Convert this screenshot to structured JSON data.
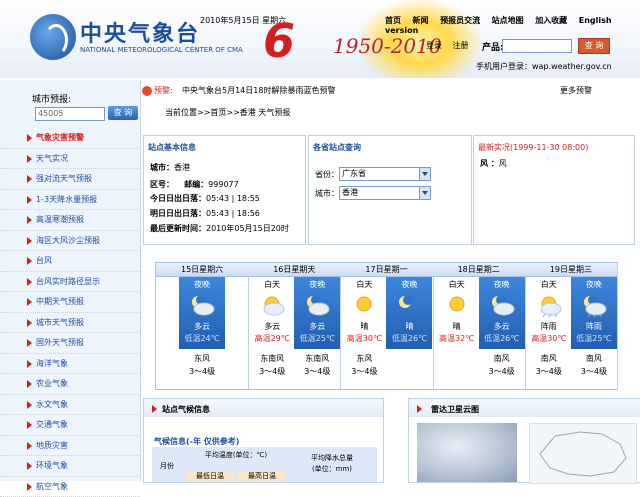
{
  "header": {
    "site_name_cn": "中央气象台",
    "site_name_en": "NATIONAL METEOROLOGICAL CENTER OF CMA",
    "date": "2010年5月15日 星期六",
    "anniversary_years": "1950-2010",
    "nav": [
      "首页",
      "新闻",
      "预报员交流",
      "站点地图",
      "加入收藏",
      "English version"
    ],
    "login": "登录",
    "register": "注册",
    "product_label": "产品:",
    "search_button": "查 询",
    "mobile_login": "手机用户登录：wap.weather.gov.cn"
  },
  "sidebar": {
    "city_label": "城市预报:",
    "city_input": "45005",
    "city_button": "查 询",
    "items": [
      {
        "label": "气象灾害预警",
        "active": true
      },
      {
        "label": "天气实况",
        "active": false
      },
      {
        "label": "强对流天气预报",
        "active": false
      },
      {
        "label": "1-3天降水量预报",
        "active": false
      },
      {
        "label": "高温寒潮预报",
        "active": false
      },
      {
        "label": "海区大风沙尘预报",
        "active": false
      },
      {
        "label": "台风",
        "active": false
      },
      {
        "label": "台风实时路径显示",
        "active": false
      },
      {
        "label": "中期天气预报",
        "active": false
      },
      {
        "label": "城市天气预报",
        "active": false
      },
      {
        "label": "国外天气预报",
        "active": false
      },
      {
        "label": "海洋气象",
        "active": false
      },
      {
        "label": "农业气象",
        "active": false
      },
      {
        "label": "水文气象",
        "active": false
      },
      {
        "label": "交通气象",
        "active": false
      },
      {
        "label": "地质灾害",
        "active": false
      },
      {
        "label": "环境气象",
        "active": false
      },
      {
        "label": "航空气象",
        "active": false
      }
    ]
  },
  "alert": {
    "tag": "预警:",
    "text": "中央气象台5月14日18时解除暴雨蓝色预警",
    "more": "更多预警"
  },
  "breadcrumb": "当前位置>>首页>>香港 天气预报",
  "station_info": {
    "title": "站点基本信息",
    "city_label": "城市：",
    "city": "香港",
    "zone_label": "区号：",
    "post_label": "邮编：",
    "post": "999077",
    "today_label": "今日日出日落：",
    "today": "05:43 | 18:55",
    "tomorrow_label": "明日日出日落：",
    "tomorrow": "05:43 | 18:56",
    "updated_label": "最后更新时间：",
    "updated": "2010年05月15日20时"
  },
  "province_panel": {
    "title": "各省站点查询",
    "province_label": "省份：",
    "province": "广东省",
    "city_label": "城市：",
    "city": "香港"
  },
  "latest_panel": {
    "title": "最新实况(1999-11-30 08:00)",
    "wind_label": "风 ：",
    "wind": "风"
  },
  "forecast": [
    {
      "date": "15日星期六",
      "day": null,
      "night": {
        "label": "夜晚",
        "icon": "cloudy-night-icon",
        "weather": "多云",
        "temp": "低温24℃",
        "wind": "东风",
        "force": "3～4级"
      }
    },
    {
      "date": "16日星期天",
      "day": {
        "label": "白天",
        "icon": "partly-cloudy-icon",
        "weather": "多云",
        "temp": "高温29℃",
        "wind": "东南风",
        "force": "3～4级"
      },
      "night": {
        "label": "夜晚",
        "icon": "cloudy-night-icon",
        "weather": "多云",
        "temp": "低温25℃",
        "wind": "东南风",
        "force": "3～4级"
      }
    },
    {
      "date": "17日星期一",
      "day": {
        "label": "白天",
        "icon": "sunny-icon",
        "weather": "晴",
        "temp": "高温30℃",
        "wind": "东风",
        "force": "3～4级"
      },
      "night": {
        "label": "夜晚",
        "icon": "clear-night-icon",
        "weather": "晴",
        "temp": "低温26℃",
        "wind": "",
        "force": ""
      }
    },
    {
      "date": "18日星期二",
      "day": {
        "label": "白天",
        "icon": "sunny-icon",
        "weather": "晴",
        "temp": "高温32℃",
        "wind": "",
        "force": ""
      },
      "night": {
        "label": "夜晚",
        "icon": "cloudy-night-icon",
        "weather": "多云",
        "temp": "低温26℃",
        "wind": "南风",
        "force": "3～4级"
      }
    },
    {
      "date": "19日星期三",
      "day": {
        "label": "白天",
        "icon": "shower-icon",
        "weather": "阵雨",
        "temp": "高温30℃",
        "wind": "南风",
        "force": "3～4级"
      },
      "night": {
        "label": "夜晚",
        "icon": "shower-night-icon",
        "weather": "阵雨",
        "temp": "低温25℃",
        "wind": "南风",
        "force": "3～4级"
      }
    }
  ],
  "climate": {
    "title": "站点气候信息",
    "subtitle": "气候信息(-年 仅供参考)",
    "col_month": "月份",
    "col_avg_temp": "平均温度(单位：℃)",
    "col_precip": "平均降水总量",
    "col_precip_unit": "(单位：mm)",
    "col_min": "最低日温",
    "col_max": "最高日温"
  },
  "radar": {
    "title": "雷达卫星云图"
  },
  "colors": {
    "brand_blue": "#1c4f9a",
    "alert_red": "#d41f1f",
    "night_blue": "#2f74c8"
  }
}
